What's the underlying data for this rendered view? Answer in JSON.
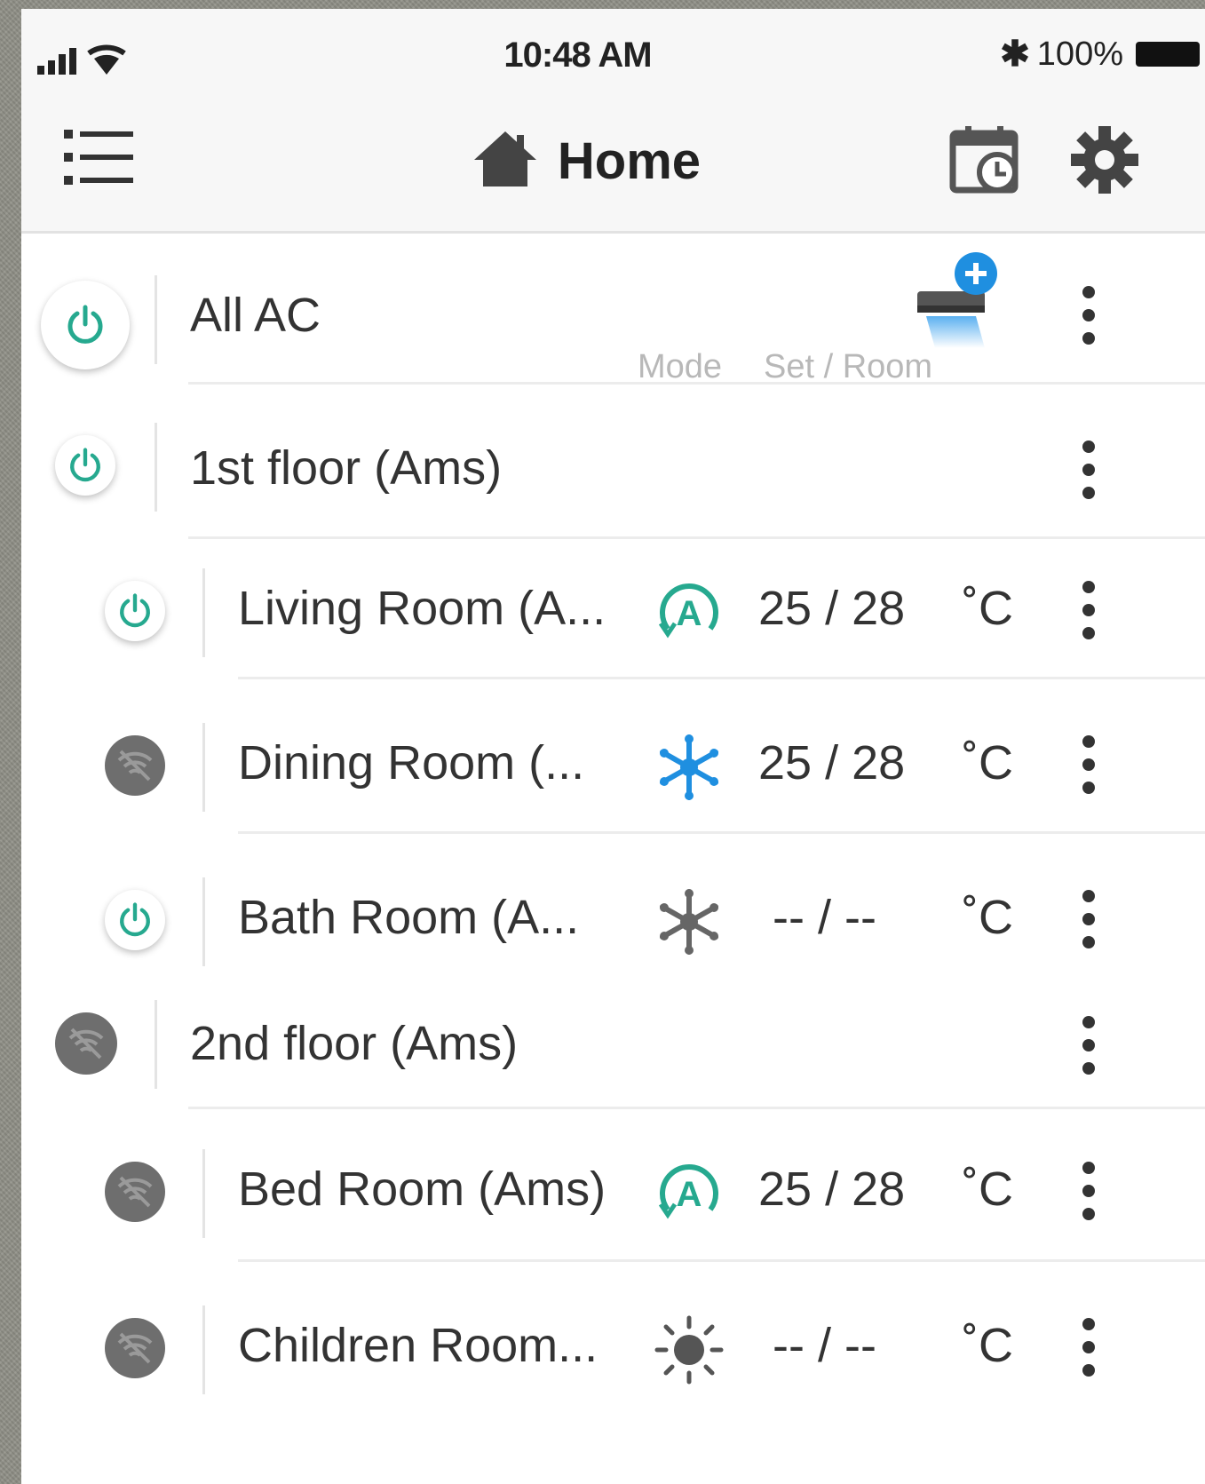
{
  "status_bar": {
    "time": "10:48 AM",
    "battery_text": "100%",
    "bluetooth_icon": "bluetooth-icon"
  },
  "nav": {
    "title": "Home",
    "menu_icon": "list-menu-icon",
    "home_icon": "home-icon",
    "schedule_icon": "calendar-clock-icon",
    "settings_icon": "gear-icon"
  },
  "all_ac": {
    "label": "All AC",
    "add_icon": "add-ac-icon",
    "caption_mode": "Mode",
    "caption_set_room": "Set / Room"
  },
  "groups": [
    {
      "label": "1st floor (Ams)",
      "state": "on"
    },
    {
      "label": "2nd floor (Ams)",
      "state": "offline"
    }
  ],
  "rooms": [
    {
      "label": "Living Room (A...",
      "state": "on",
      "mode": "auto",
      "mode_icon": "auto-mode-icon",
      "temp": "25 / 28",
      "unit": "˚C"
    },
    {
      "label": "Dining Room (...",
      "state": "offline",
      "mode": "cool",
      "mode_icon": "snowflake-icon",
      "temp": "25 / 28",
      "unit": "˚C"
    },
    {
      "label": "Bath Room (A...",
      "state": "on",
      "mode": "cool-inactive",
      "mode_icon": "snowflake-icon",
      "temp": "-- / --",
      "unit": "˚C"
    },
    {
      "label": "Bed Room (Ams)",
      "state": "offline",
      "mode": "auto",
      "mode_icon": "auto-mode-icon",
      "temp": "25 / 28",
      "unit": "˚C"
    },
    {
      "label": "Children Room...",
      "state": "offline",
      "mode": "heat",
      "mode_icon": "sun-icon",
      "temp": "-- / --",
      "unit": "˚C"
    }
  ],
  "colors": {
    "accent_teal": "#26a98f",
    "cool_blue": "#1f8fe0",
    "offline_gray": "#6e6e6e"
  }
}
